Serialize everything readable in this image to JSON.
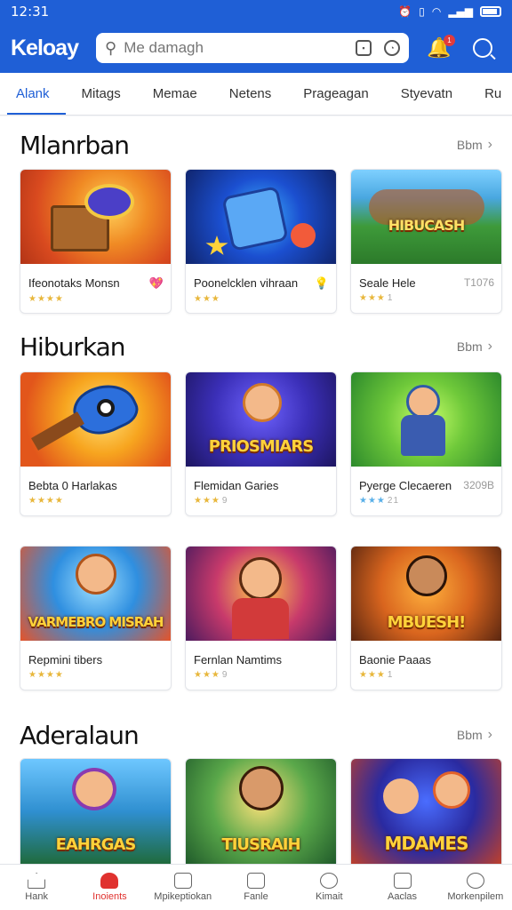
{
  "status": {
    "time": "12:31",
    "icons": [
      "alarm-icon",
      "vibrate-icon",
      "wifi-icon",
      "signal-icon",
      "battery-icon"
    ]
  },
  "appbar": {
    "brand": "Keloay",
    "search_placeholder": "Me damagh",
    "notif_count": "1"
  },
  "tabs": [
    "Alank",
    "Mitags",
    "Memae",
    "Netens",
    "Prageagan",
    "Styevatn",
    "Ru"
  ],
  "sections": [
    {
      "title": "Mlanrban",
      "see_all": "Bbm",
      "cards": [
        {
          "title": "Ifeonotaks Monsn",
          "extra": "",
          "badge": "💖",
          "rating": "★★★★",
          "rating_num": "",
          "logo": ""
        },
        {
          "title": "Poonelcklen vihraan",
          "extra": "",
          "badge": "💡",
          "rating": "★★★",
          "rating_num": "",
          "logo": ""
        },
        {
          "title": "Seale Hele",
          "extra": "T1076",
          "badge": "",
          "rating": "★★★",
          "rating_num": "1",
          "logo": "HIBUCASH"
        }
      ]
    },
    {
      "title": "Hiburkan",
      "see_all": "Bbm",
      "cards": [
        {
          "title": "Bebta 0 Harlakas",
          "extra": "",
          "badge": "",
          "rating": "★★★★",
          "rating_num": "",
          "logo": ""
        },
        {
          "title": "Flemidan Garies",
          "extra": "",
          "badge": "",
          "rating": "★★★",
          "rating_num": "9",
          "logo": "PRIOSMIARS"
        },
        {
          "title": "Pyerge Clecaeren",
          "extra": "3209B",
          "badge": "",
          "rating": "★★★",
          "rating_num": "21",
          "logo": ""
        }
      ]
    },
    {
      "title": "",
      "see_all": "",
      "cards": [
        {
          "title": "Repmini tibers",
          "extra": "",
          "badge": "",
          "rating": "★★★★",
          "rating_num": "",
          "logo": "VARMEBRO MISRAH"
        },
        {
          "title": "Fernlan Namtims",
          "extra": "",
          "badge": "",
          "rating": "★★★",
          "rating_num": "9",
          "logo": ""
        },
        {
          "title": "Baonie Paaas",
          "extra": "",
          "badge": "",
          "rating": "★★★",
          "rating_num": "1",
          "logo": "MBUESH!"
        }
      ]
    },
    {
      "title": "Aderalaun",
      "see_all": "Bbm",
      "cards": [
        {
          "title": "",
          "extra": "",
          "badge": "",
          "rating": "",
          "rating_num": "",
          "logo": "EAHRGAS"
        },
        {
          "title": "",
          "extra": "",
          "badge": "",
          "rating": "",
          "rating_num": "",
          "logo": "TIUSRAIH"
        },
        {
          "title": "",
          "extra": "",
          "badge": "",
          "rating": "",
          "rating_num": "",
          "logo": "MDAMES"
        }
      ]
    }
  ],
  "bottom_nav": [
    {
      "label": "Hank",
      "icon": "home-icon"
    },
    {
      "label": "Inoients",
      "icon": "heart-icon"
    },
    {
      "label": "Mpikeptiokan",
      "icon": "apps-icon"
    },
    {
      "label": "Fanle",
      "icon": "games-icon"
    },
    {
      "label": "Kimait",
      "icon": "chat-icon"
    },
    {
      "label": "Aaclas",
      "icon": "library-icon"
    },
    {
      "label": "Morkenpilem",
      "icon": "profile-icon"
    }
  ],
  "colors": {
    "primary": "#1f5fd6",
    "active_nav": "#e0322f",
    "star": "#e8b73c"
  }
}
